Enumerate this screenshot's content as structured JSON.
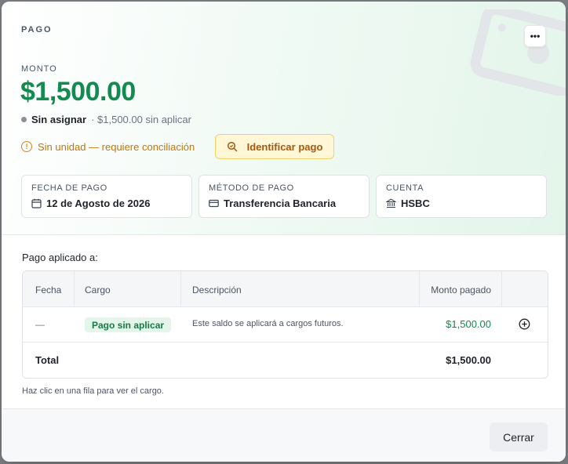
{
  "header": {
    "kicker": "PAGO",
    "more_label": "•••"
  },
  "summary": {
    "amount_label": "MONTO",
    "amount": "$1,500.00",
    "status": "Sin asignar",
    "status_sub": "· $1,500.00 sin aplicar",
    "warning": "Sin unidad — requiere conciliación",
    "identify_button": "Identificar pago"
  },
  "info": {
    "fecha_label": "FECHA DE PAGO",
    "fecha_value": "12 de Agosto de 2026",
    "metodo_label": "MÉTODO DE PAGO",
    "metodo_value": "Transferencia Bancaria",
    "cuenta_label": "CUENTA",
    "cuenta_value": "HSBC"
  },
  "applied": {
    "title": "Pago aplicado a:",
    "columns": {
      "fecha": "Fecha",
      "cargo": "Cargo",
      "descripcion": "Descripción",
      "monto": "Monto pagado"
    },
    "rows": [
      {
        "fecha": "—",
        "cargo": "Pago sin aplicar",
        "descripcion": "Este saldo se aplicará a cargos futuros.",
        "monto": "$1,500.00"
      }
    ],
    "total_label": "Total",
    "total_value": "$1,500.00",
    "hint": "Haz clic en una fila para ver el cargo."
  },
  "footer": {
    "close_label": "Cerrar"
  },
  "colors": {
    "accent_green": "#138a4f",
    "warning": "#c2760a",
    "badge_bg": "#e4f5ea"
  },
  "icons": {
    "more": "ellipsis-icon",
    "warning": "alert-circle-icon",
    "identify": "search-icon",
    "fecha": "calendar-icon",
    "metodo": "credit-card-icon",
    "cuenta": "bank-icon",
    "row_action": "plus-circle-icon"
  }
}
